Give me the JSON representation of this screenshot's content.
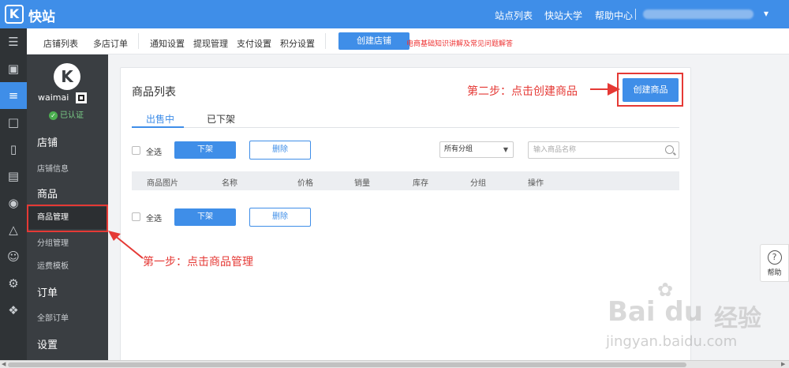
{
  "app": {
    "logo_letter": "K",
    "title": "快站"
  },
  "topbar": {
    "links": [
      "站点列表",
      "快站大学",
      "帮助中心"
    ],
    "caret": "▾"
  },
  "rail": {
    "icons": [
      "layers-icon",
      "monitor-icon",
      "cart-list-icon",
      "chat-icon",
      "tablet-icon",
      "document-icon",
      "wechat-icon",
      "antenna-icon",
      "user-icon",
      "gear-icon",
      "puzzle-icon"
    ]
  },
  "sidebar": {
    "avatar_letter": "K",
    "shop_name": "waimai",
    "verified_label": "已认证",
    "groups": {
      "store": "店铺",
      "product": "商品",
      "order": "订单",
      "settings": "设置"
    },
    "items": {
      "store_info": "店铺信息",
      "product_manage": "商品管理",
      "group_manage": "分组管理",
      "freight_template": "运费模板",
      "all_orders": "全部订单"
    }
  },
  "subnav": {
    "links": [
      "店铺列表",
      "多店订单",
      "通知设置",
      "提现管理",
      "支付设置",
      "积分设置"
    ],
    "create_store": "创建店铺",
    "notice": "电商基础知识讲解及常见问题解答"
  },
  "main": {
    "title": "商品列表",
    "create_product": "创建商品",
    "tabs": [
      "出售中",
      "已下架"
    ],
    "select_all": "全选",
    "take_down": "下架",
    "delete": "删除",
    "group_select": "所有分组",
    "search_placeholder": "输入商品名称",
    "columns": [
      "商品图片",
      "名称",
      "价格",
      "销量",
      "库存",
      "分组",
      "操作"
    ]
  },
  "annotations": {
    "step1": "第一步：点击商品管理",
    "step2": "第二步：点击创建商品"
  },
  "help": {
    "label": "帮助",
    "icon_glyph": "?"
  },
  "watermark": {
    "brand": "Bai  du",
    "cn": "经验",
    "url": "jingyan.baidu.com"
  },
  "colors": {
    "primary": "#3f8ee8",
    "annotation": "#e53935",
    "sidebar": "#3a3e42",
    "rail": "#2f3336"
  }
}
